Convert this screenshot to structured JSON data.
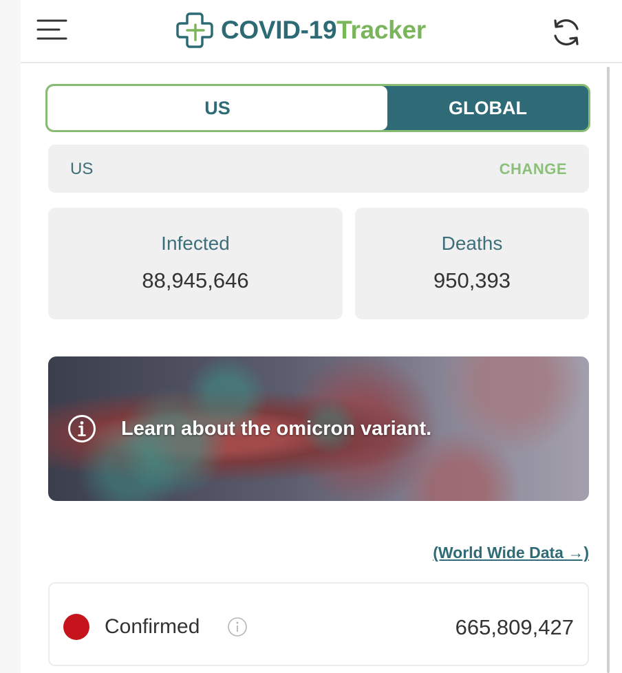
{
  "header": {
    "brand_part1": "COVID-19",
    "brand_part2": "Tracker",
    "menu_icon": "hamburger-menu-icon",
    "refresh_icon": "refresh-icon"
  },
  "region_toggle": {
    "options": [
      "US",
      "GLOBAL"
    ],
    "selected": "US"
  },
  "location": {
    "name": "US",
    "change_label": "CHANGE"
  },
  "stats": {
    "infected_label": "Infected",
    "infected_value": "88,945,646",
    "deaths_label": "Deaths",
    "deaths_value": "950,393"
  },
  "banner": {
    "text": "Learn about the omicron variant.",
    "icon": "info-icon"
  },
  "world_link": "(World Wide Data →)",
  "confirmed": {
    "label": "Confirmed",
    "value": "665,809,427",
    "dot_color": "#c5141b"
  },
  "colors": {
    "primary": "#2f6b76",
    "accent": "#7ab55c",
    "danger": "#c5141b"
  }
}
